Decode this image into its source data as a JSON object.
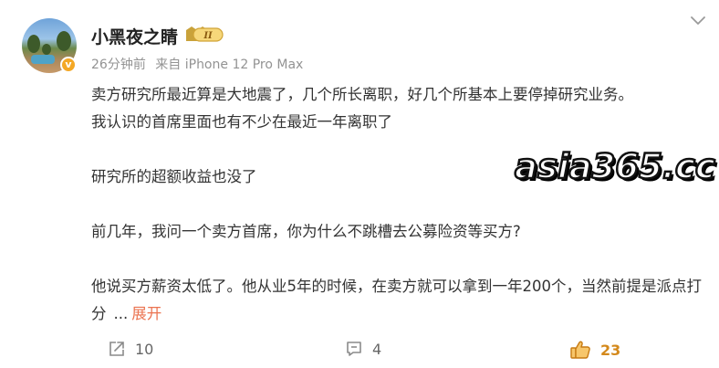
{
  "post": {
    "username": "小黑夜之睛",
    "level_badge": "II",
    "verified_mark": "v",
    "time_ago": "26分钟前",
    "source": "来自 iPhone 12 Pro Max",
    "paragraphs": [
      "卖方研究所最近算是大地震了，几个所长离职，好几个所基本上要停掉研究业务。",
      "我认识的首席里面也有不少在最近一年离职了",
      "研究所的超额收益也没了",
      "前几年，我问一个卖方首席，你为什么不跳槽去公募险资等买方?",
      "他说买方薪资太低了。他从业5年的时候，在卖方就可以拿到一年200个，当然前提是派点打分"
    ],
    "ellipsis": "...",
    "expand_label": "展开"
  },
  "watermark": "asia365.cc",
  "actions": {
    "repost_count": "10",
    "comment_count": "4",
    "like_count": "23"
  },
  "colors": {
    "expand": "#eb7350",
    "like": "#d4891c",
    "meta": "#939393",
    "verified": "#f4a826"
  },
  "icons": [
    "more-chevron-icon",
    "repost-icon",
    "comment-icon",
    "like-thumb-icon",
    "verified-icon",
    "level-badge-icon"
  ]
}
